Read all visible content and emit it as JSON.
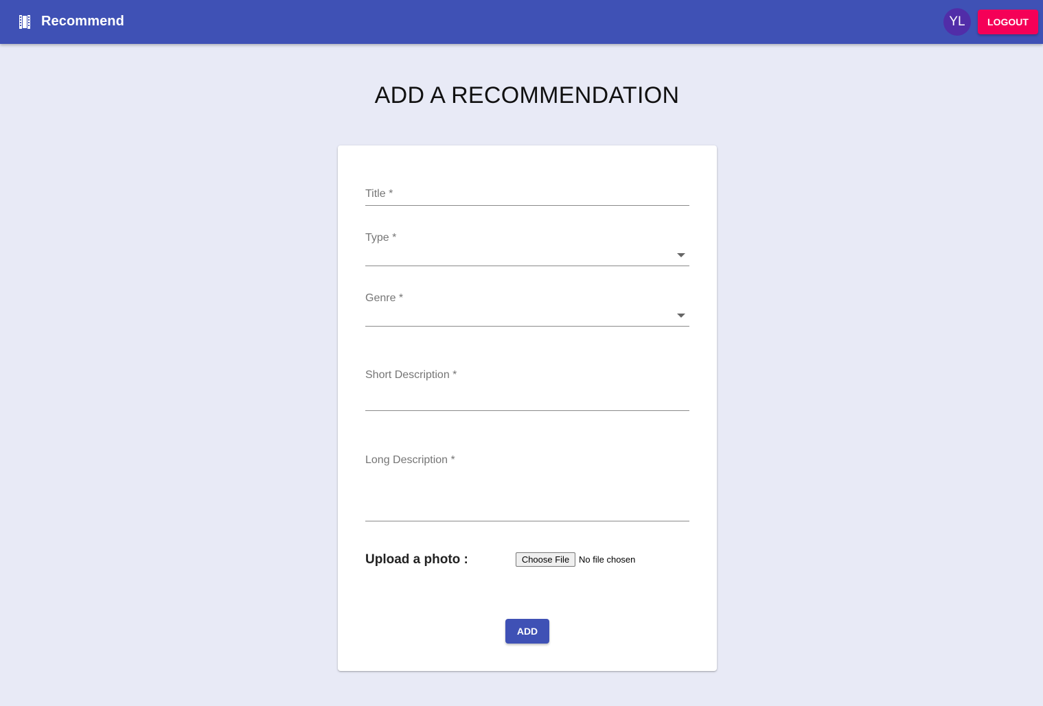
{
  "appbar": {
    "brand_icon": "movie-film-icon",
    "brand_title": "Recommend",
    "avatar_initials": "YL",
    "logout_label": "LOGOUT"
  },
  "page": {
    "title": "ADD A RECOMMENDATION"
  },
  "form": {
    "title_label": "Title *",
    "type_label": "Type *",
    "genre_label": "Genre *",
    "short_description_label": "Short Description *",
    "long_description_label": "Long Description *",
    "upload_label": "Upload a photo :",
    "choose_file_label": "Choose File",
    "file_status": "No file chosen",
    "submit_label": "ADD"
  },
  "colors": {
    "primary": "#3f51b5",
    "secondary": "#f50057",
    "avatar": "#512da8",
    "background": "#e8eaf6"
  }
}
